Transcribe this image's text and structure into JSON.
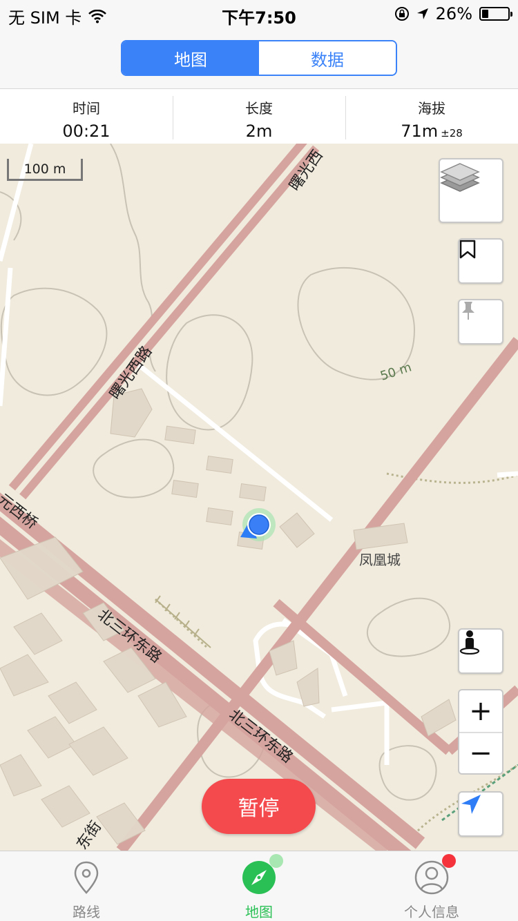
{
  "status_bar": {
    "carrier": "无 SIM 卡",
    "time": "下午7:50",
    "battery": "26%",
    "battery_level": 0.26
  },
  "segmented": {
    "map_label": "地图",
    "data_label": "数据"
  },
  "stats": {
    "time": {
      "label": "时间",
      "value": "00:21"
    },
    "length": {
      "label": "长度",
      "value": "2m"
    },
    "altitude": {
      "label": "海拔",
      "value": "71m",
      "accuracy": "±28"
    }
  },
  "map": {
    "scale_label": "100 m",
    "contour_label": "50 m",
    "place_label": "凤凰城",
    "road_labels": {
      "shuguang_top": "曙光西",
      "shuguang_mid": "曙光西路",
      "beisanhuan_1": "北三环东路",
      "beisanhuan_2": "北三环东路",
      "yuanxiqiao": "元西桥",
      "street_bottom": "东街"
    }
  },
  "controls": {
    "zoom_in": "+",
    "zoom_out": "−",
    "pause_label": "暂停"
  },
  "tabbar": {
    "route_label": "路线",
    "map_label": "地图",
    "profile_label": "个人信息"
  },
  "colors": {
    "accent": "#3a82f7",
    "pause": "#f4494d",
    "tab_active": "#2ac055",
    "road": "#d9aaa3",
    "map_bg": "#f0ebdd",
    "badge_red": "#f4333c",
    "badge_green": "#a8e6b2"
  },
  "icons": [
    "wifi-icon",
    "lock-rotation-icon",
    "location-arrow-icon",
    "battery-icon",
    "layers-icon",
    "bookmark-icon",
    "pin-icon",
    "person-icon",
    "navigate-icon",
    "route-pin-icon",
    "compass-icon",
    "profile-icon"
  ]
}
